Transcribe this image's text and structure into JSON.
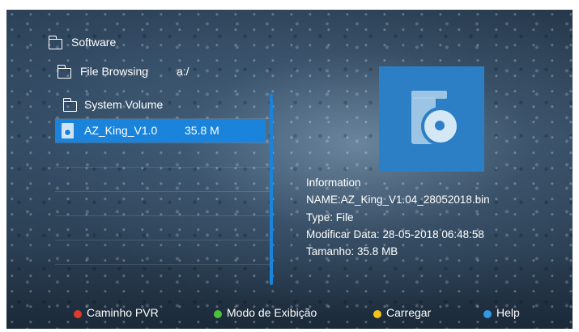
{
  "browser": {
    "title": "Software",
    "location_label": "File Browsing",
    "location_path": "a:/",
    "folder_item": "System Volume",
    "selected_file": {
      "name": "AZ_King_V1.0",
      "size": "35.8 M"
    }
  },
  "info": {
    "heading": "Information",
    "name_line": "NAME:AZ_King_V1.04_28052018.bin",
    "type_line": "Type: File",
    "modified_line": "Modificar Data: 28-05-2018 06:48:58",
    "size_line": "Tamanho: 35.8 MB"
  },
  "legend": [
    {
      "label": "Caminho PVR",
      "color": "#e03a2c",
      "icon": "red-button-icon"
    },
    {
      "label": "Modo de Exibição",
      "color": "#4cc23a",
      "icon": "green-button-icon"
    },
    {
      "label": "Carregar",
      "color": "#f0c419",
      "icon": "yellow-button-icon"
    },
    {
      "label": "Help",
      "color": "#2f9be0",
      "icon": "blue-button-icon"
    }
  ],
  "colors": {
    "selection": "#1a84dc",
    "preview_tile": "#2c7fc4"
  }
}
